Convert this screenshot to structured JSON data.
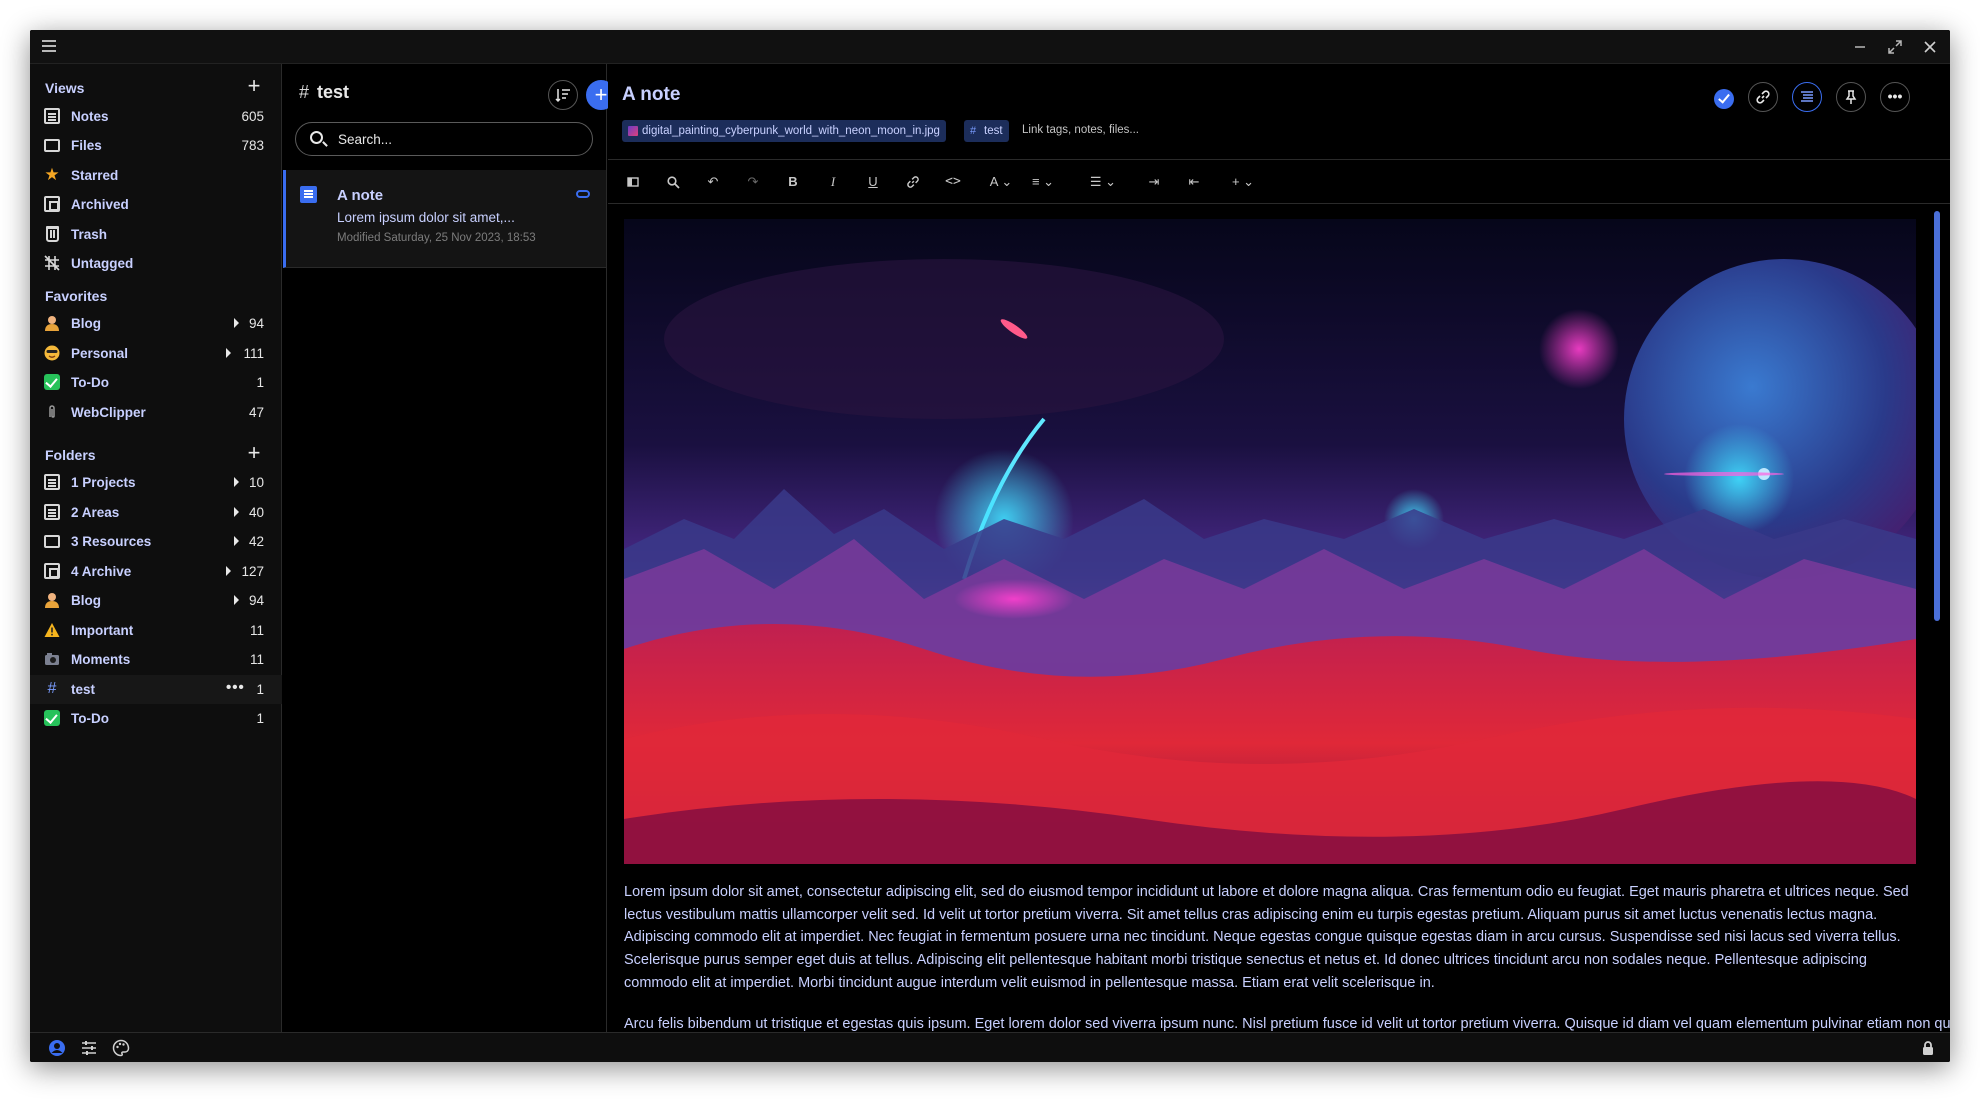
{
  "sidebar": {
    "views_heading": "Views",
    "views": [
      {
        "label": "Notes",
        "count": "605",
        "icon": "note-icon"
      },
      {
        "label": "Files",
        "count": "783",
        "icon": "folder-icon"
      },
      {
        "label": "Starred",
        "count": "",
        "icon": "star-icon"
      },
      {
        "label": "Archived",
        "count": "",
        "icon": "archive-icon"
      },
      {
        "label": "Trash",
        "count": "",
        "icon": "trash-icon"
      },
      {
        "label": "Untagged",
        "count": "",
        "icon": "untagged-icon"
      }
    ],
    "favorites_heading": "Favorites",
    "favorites": [
      {
        "label": "Blog",
        "count": "94",
        "icon": "person-icon"
      },
      {
        "label": "Personal",
        "count": "111",
        "icon": "smiley-icon"
      },
      {
        "label": "To-Do",
        "count": "1",
        "icon": "checkbox-icon"
      },
      {
        "label": "WebClipper",
        "count": "47",
        "icon": "paperclip-icon"
      }
    ],
    "folders_heading": "Folders",
    "folders": [
      {
        "label": "1 Projects",
        "count": "10",
        "icon": "document-icon"
      },
      {
        "label": "2 Areas",
        "count": "40",
        "icon": "note-icon"
      },
      {
        "label": "3 Resources",
        "count": "42",
        "icon": "folder-icon"
      },
      {
        "label": "4 Archive",
        "count": "127",
        "icon": "archive-icon"
      },
      {
        "label": "Blog",
        "count": "94",
        "icon": "person-icon"
      },
      {
        "label": "Important",
        "count": "11",
        "icon": "warning-icon"
      },
      {
        "label": "Moments",
        "count": "11",
        "icon": "camera-icon"
      },
      {
        "label": "test",
        "count": "1",
        "icon": "hash-icon"
      },
      {
        "label": "To-Do",
        "count": "1",
        "icon": "checkbox-icon"
      }
    ]
  },
  "notelist": {
    "title": "test",
    "search_placeholder": "Search...",
    "notes": [
      {
        "title": "A note",
        "snippet": "Lorem ipsum dolor sit amet,...",
        "modified": "Modified Saturday, 25 Nov 2023, 18:53"
      }
    ]
  },
  "editor": {
    "title": "A note",
    "attachment_chip": "digital_painting_cyberpunk_world_with_neon_moon_in.jpg",
    "tag_chip": "test",
    "link_placeholder": "Link tags, notes, files...",
    "paragraph1": "Lorem ipsum dolor sit amet, consectetur adipiscing elit, sed do eiusmod tempor incididunt ut labore et dolore magna aliqua. Cras fermentum odio eu feugiat. Eget mauris pharetra et ultrices neque. Sed lectus vestibulum mattis ullamcorper velit sed. Id velit ut tortor pretium viverra. Sit amet tellus cras adipiscing enim eu turpis egestas pretium. Aliquam purus sit amet luctus venenatis lectus magna. Adipiscing commodo elit at imperdiet. Nec feugiat in fermentum posuere urna nec tincidunt. Neque egestas congue quisque egestas diam in arcu cursus. Suspendisse sed nisi lacus sed viverra tellus. Scelerisque purus semper eget duis at tellus. Adipiscing elit pellentesque habitant morbi tristique senectus et netus et. Id donec ultrices tincidunt arcu non sodales neque. Pellentesque adipiscing commodo elit at imperdiet. Morbi tincidunt augue interdum velit euismod in pellentesque massa. Etiam erat velit scelerisque in.",
    "paragraph2": "Arcu felis bibendum ut tristique et egestas quis ipsum. Eget lorem dolor sed viverra ipsum nunc. Nisl pretium fusce id velit ut tortor pretium viverra. Quisque id diam vel quam elementum pulvinar etiam non quam lacus suspendisse."
  },
  "colors": {
    "accent": "#3a6df0",
    "text": "#c8d0ff",
    "background": "#000000",
    "sidebar": "#0e0e0e"
  }
}
